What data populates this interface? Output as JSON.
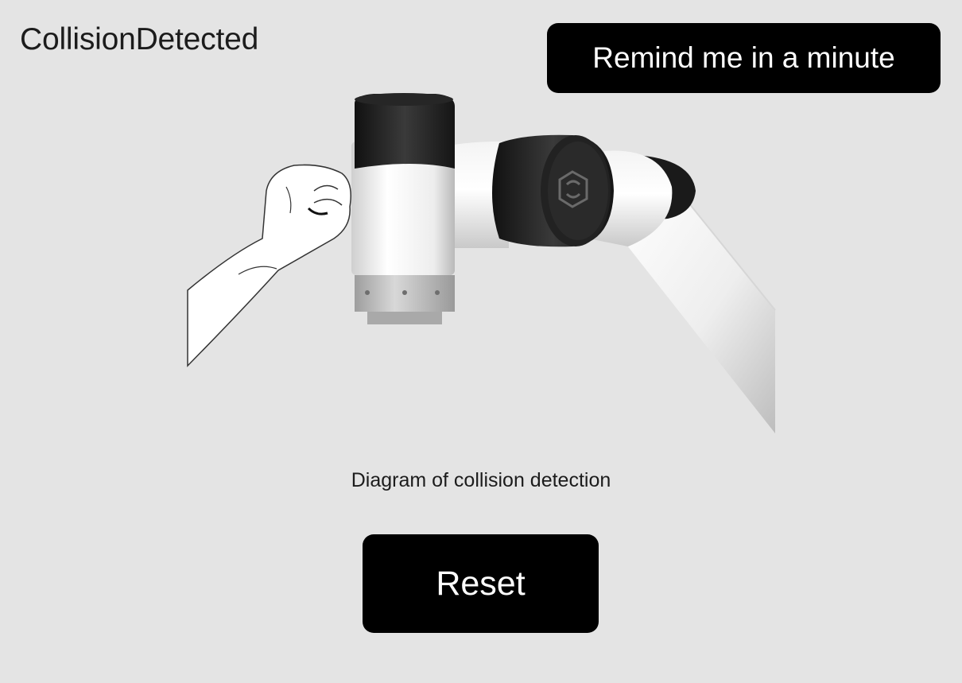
{
  "header": {
    "title": "CollisionDetected",
    "remind_label": "Remind me in a minute"
  },
  "main": {
    "caption": "Diagram of collision detection",
    "reset_label": "Reset"
  }
}
